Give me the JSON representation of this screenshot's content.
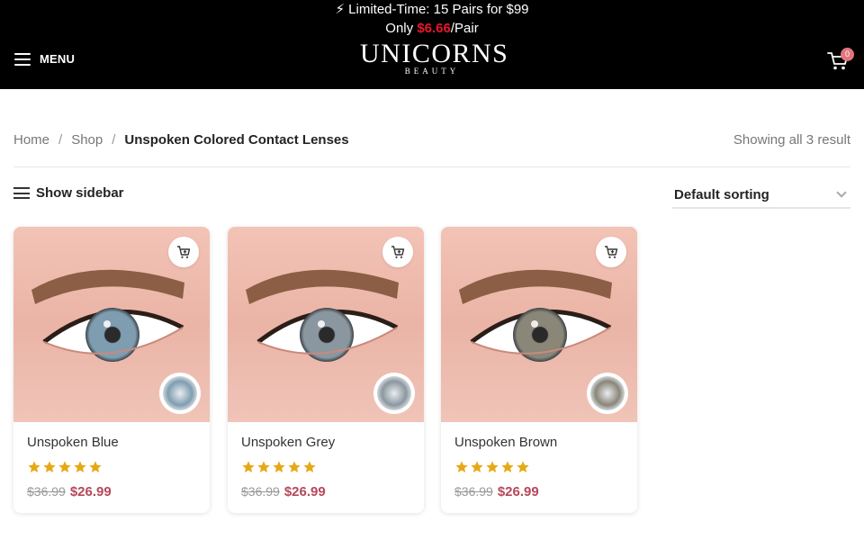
{
  "promo": {
    "line1": "⚡ Limited-Time: 15 Pairs for $99",
    "line2_prefix": "Only ",
    "line2_price": "$6.66",
    "line2_suffix": "/Pair"
  },
  "header": {
    "menu_label": "MENU",
    "logo_main": "UNICORNS",
    "logo_sub": "BEAUTY",
    "cart_count": "0"
  },
  "breadcrumb": {
    "home": "Home",
    "shop": "Shop",
    "separator": "/",
    "current": "Unspoken Colored Contact Lenses"
  },
  "result_count": "Showing all 3 result",
  "toolbar": {
    "sidebar_label": "Show sidebar",
    "sorting_label": "Default sorting"
  },
  "products": [
    {
      "name": "Unspoken Blue",
      "old_price": "$36.99",
      "new_price": "$26.99",
      "rating": 5,
      "iris_color": "#7f9db1"
    },
    {
      "name": "Unspoken Grey",
      "old_price": "$36.99",
      "new_price": "$26.99",
      "rating": 5,
      "iris_color": "#8b97a0"
    },
    {
      "name": "Unspoken Brown",
      "old_price": "$36.99",
      "new_price": "$26.99",
      "rating": 5,
      "iris_color": "#8a8678"
    }
  ],
  "colors": {
    "header_bg": "#000000",
    "promo_price": "#e8162d",
    "sale_price": "#b5485a",
    "star": "#e6a915",
    "cart_badge": "#e3747d"
  }
}
